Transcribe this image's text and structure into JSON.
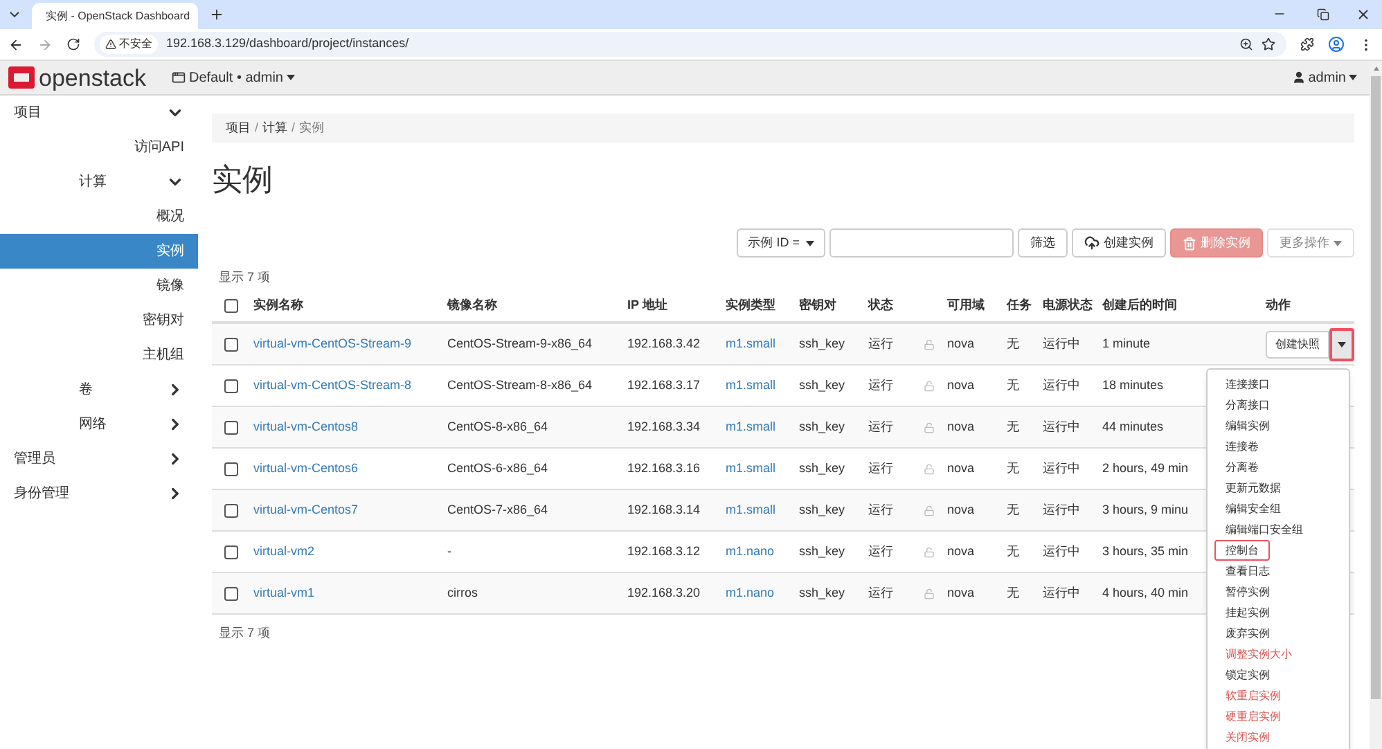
{
  "browser": {
    "tab_title": "实例 - OpenStack Dashboard",
    "security_label": "不安全",
    "url": "192.168.3.129/dashboard/project/instances/"
  },
  "header": {
    "logo_text": "openstack",
    "project": "Default • admin",
    "user": "admin"
  },
  "sidebar": {
    "items": [
      {
        "label": "项目",
        "expanded": true,
        "selected": false,
        "children": [
          {
            "label": "访问API",
            "selected": false
          },
          {
            "label": "计算",
            "expanded": true,
            "selected": false,
            "children": [
              {
                "label": "概况",
                "selected": false
              },
              {
                "label": "实例",
                "selected": true
              },
              {
                "label": "镜像",
                "selected": false
              },
              {
                "label": "密钥对",
                "selected": false
              },
              {
                "label": "主机组",
                "selected": false
              }
            ]
          },
          {
            "label": "卷",
            "expanded": false,
            "selected": false
          },
          {
            "label": "网络",
            "expanded": false,
            "selected": false
          }
        ]
      },
      {
        "label": "管理员",
        "expanded": false,
        "selected": false
      },
      {
        "label": "身份管理",
        "expanded": false,
        "selected": false
      }
    ]
  },
  "breadcrumb": [
    "项目",
    "计算",
    "实例"
  ],
  "breadcrumb_separator": "/",
  "page_title": "实例",
  "toolbar": {
    "filter_select": "示例 ID = ",
    "buttons": [
      {
        "label": "筛选",
        "kind": "default",
        "disabled": false
      },
      {
        "label": "创建实例",
        "kind": "create",
        "disabled": false
      },
      {
        "label": "删除实例",
        "kind": "danger",
        "disabled": true
      },
      {
        "label": "更多操作",
        "kind": "more",
        "disabled": true
      }
    ]
  },
  "count_top": "显示 7 项",
  "table": {
    "select_all_checked": false,
    "columns": [
      "实例名称",
      "镜像名称",
      "IP 地址",
      "实例类型",
      "密钥对",
      "状态",
      "可用域",
      "任务",
      "电源状态",
      "创建后的时间",
      "动作"
    ],
    "rows": [
      {
        "checked": false,
        "name": "virtual-vm-CentOS-Stream-9",
        "image": "CentOS-Stream-9-x86_64",
        "ip": "192.168.3.42",
        "flavor": "m1.small",
        "key_pair": "ssh_key",
        "status": "运行",
        "locked": false,
        "zone": "nova",
        "task": "无",
        "power": "运行中",
        "age": "1 minute",
        "action": "创建快照",
        "menu_highlighted": true
      },
      {
        "checked": false,
        "name": "virtual-vm-CentOS-Stream-8",
        "image": "CentOS-Stream-8-x86_64",
        "ip": "192.168.3.17",
        "flavor": "m1.small",
        "key_pair": "ssh_key",
        "status": "运行",
        "locked": false,
        "zone": "nova",
        "task": "无",
        "power": "运行中",
        "age": "18 minutes"
      },
      {
        "checked": false,
        "name": "virtual-vm-Centos8",
        "image": "CentOS-8-x86_64",
        "ip": "192.168.3.34",
        "flavor": "m1.small",
        "key_pair": "ssh_key",
        "status": "运行",
        "locked": false,
        "zone": "nova",
        "task": "无",
        "power": "运行中",
        "age": "44 minutes"
      },
      {
        "checked": false,
        "name": "virtual-vm-Centos6",
        "image": "CentOS-6-x86_64",
        "ip": "192.168.3.16",
        "flavor": "m1.small",
        "key_pair": "ssh_key",
        "status": "运行",
        "locked": false,
        "zone": "nova",
        "task": "无",
        "power": "运行中",
        "age": "2 hours, 49 min"
      },
      {
        "checked": false,
        "name": "virtual-vm-Centos7",
        "image": "CentOS-7-x86_64",
        "ip": "192.168.3.14",
        "flavor": "m1.small",
        "key_pair": "ssh_key",
        "status": "运行",
        "locked": false,
        "zone": "nova",
        "task": "无",
        "power": "运行中",
        "age": "3 hours, 9 minu"
      },
      {
        "checked": false,
        "name": "virtual-vm2",
        "image": "-",
        "ip": "192.168.3.12",
        "flavor": "m1.nano",
        "key_pair": "ssh_key",
        "status": "运行",
        "locked": false,
        "zone": "nova",
        "task": "无",
        "power": "运行中",
        "age": "3 hours, 35 min"
      },
      {
        "checked": false,
        "name": "virtual-vm1",
        "image": "cirros",
        "ip": "192.168.3.20",
        "flavor": "m1.nano",
        "key_pair": "ssh_key",
        "status": "运行",
        "locked": false,
        "zone": "nova",
        "task": "无",
        "power": "运行中",
        "age": "4 hours, 40 min"
      }
    ]
  },
  "count_bottom": "显示 7 项",
  "action_menu": {
    "items": [
      {
        "label": "连接接口",
        "danger": false,
        "highlighted": false
      },
      {
        "label": "分离接口",
        "danger": false,
        "highlighted": false
      },
      {
        "label": "编辑实例",
        "danger": false,
        "highlighted": false
      },
      {
        "label": "连接卷",
        "danger": false,
        "highlighted": false
      },
      {
        "label": "分离卷",
        "danger": false,
        "highlighted": false
      },
      {
        "label": "更新元数据",
        "danger": false,
        "highlighted": false
      },
      {
        "label": "编辑安全组",
        "danger": false,
        "highlighted": false
      },
      {
        "label": "编辑端口安全组",
        "danger": false,
        "highlighted": false
      },
      {
        "label": "控制台",
        "danger": false,
        "highlighted": true
      },
      {
        "label": "查看日志",
        "danger": false,
        "highlighted": false
      },
      {
        "label": "暂停实例",
        "danger": false,
        "highlighted": false
      },
      {
        "label": "挂起实例",
        "danger": false,
        "highlighted": false
      },
      {
        "label": "废弃实例",
        "danger": false,
        "highlighted": false
      },
      {
        "label": "调整实例大小",
        "danger": true,
        "highlighted": false
      },
      {
        "label": "锁定实例",
        "danger": false,
        "highlighted": false
      },
      {
        "label": "软重启实例",
        "danger": true,
        "highlighted": false
      },
      {
        "label": "硬重启实例",
        "danger": true,
        "highlighted": false
      },
      {
        "label": "关闭实例",
        "danger": true,
        "highlighted": false
      }
    ]
  }
}
